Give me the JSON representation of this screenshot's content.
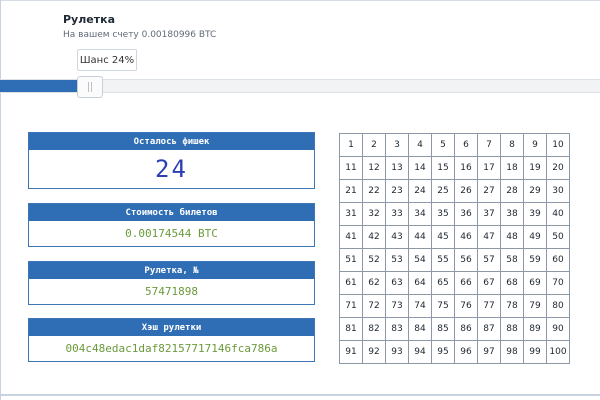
{
  "header": {
    "title": "Рулетка",
    "balance_text": "На вашем счету 0.00180996 BTC"
  },
  "slider": {
    "chance_label": "Шанс 24%",
    "value_percent": 24
  },
  "panels": {
    "chips": {
      "label": "Осталось фишек",
      "value": "24"
    },
    "ticket_cost": {
      "label": "Стоимость билетов",
      "value": "0.00174544 BTC"
    },
    "roulette_no": {
      "label": "Рулетка, №",
      "value": "57471898"
    },
    "roulette_hash": {
      "label": "Хэш рулетки",
      "value": "004c48edac1daf82157717146fca786a"
    }
  },
  "grid": {
    "numbers": [
      "1",
      "2",
      "3",
      "4",
      "5",
      "6",
      "7",
      "8",
      "9",
      "10",
      "11",
      "12",
      "13",
      "14",
      "15",
      "16",
      "17",
      "18",
      "19",
      "20",
      "21",
      "22",
      "23",
      "24",
      "25",
      "26",
      "27",
      "28",
      "29",
      "30",
      "31",
      "32",
      "33",
      "34",
      "35",
      "36",
      "37",
      "38",
      "39",
      "40",
      "41",
      "42",
      "43",
      "44",
      "45",
      "46",
      "47",
      "48",
      "49",
      "50",
      "51",
      "52",
      "53",
      "54",
      "55",
      "56",
      "57",
      "58",
      "59",
      "60",
      "61",
      "62",
      "63",
      "64",
      "65",
      "66",
      "67",
      "68",
      "69",
      "70",
      "71",
      "72",
      "73",
      "74",
      "75",
      "76",
      "77",
      "78",
      "79",
      "80",
      "81",
      "82",
      "83",
      "84",
      "85",
      "86",
      "87",
      "88",
      "89",
      "90",
      "91",
      "92",
      "93",
      "94",
      "95",
      "96",
      "97",
      "98",
      "99",
      "100"
    ]
  },
  "colors": {
    "accent": "#2f6db5",
    "counter": "#2b3fb0",
    "value_green": "#6b9a3c"
  }
}
